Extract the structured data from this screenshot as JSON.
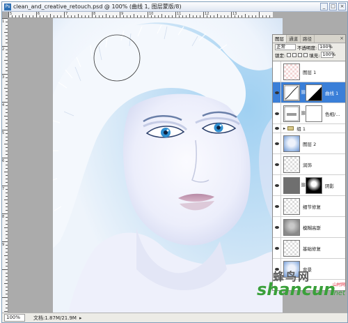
{
  "window": {
    "title": "clean_and_creative_retouch.psd @ 100% (曲线 1, 图层蒙版/8)",
    "app_icon": "Ps",
    "buttons": {
      "minimize": "_",
      "maximize": "□",
      "close": "×"
    }
  },
  "rulers": {
    "top_labels": [
      "5",
      "6",
      "7",
      "8",
      "9",
      "10",
      "11",
      "12",
      "13"
    ],
    "left_labels": [
      "1",
      "2",
      "3",
      "4",
      "5",
      "6",
      "7",
      "8",
      "9"
    ]
  },
  "status_bar": {
    "zoom": "100%",
    "doc_size": "文档:1.87M/21.9M",
    "arrow": "▸"
  },
  "layers_panel": {
    "tabs": [
      "图层",
      "通道",
      "路径"
    ],
    "active_tab": "图层",
    "close": "×",
    "blend_mode": "正常",
    "opacity_label": "不透明度:",
    "opacity_value": "100%",
    "lock_label": "锁定:",
    "fill_label": "填充:",
    "fill_value": "100%",
    "layers": [
      {
        "name": "图层 1",
        "visible": false,
        "selected": false,
        "type": "pixel",
        "thumb": "checker-red"
      },
      {
        "name": "曲线 1",
        "visible": true,
        "selected": true,
        "type": "adjustment",
        "thumb": "curves"
      },
      {
        "name": "色相/...",
        "visible": true,
        "selected": false,
        "type": "adjustment",
        "thumb": "hue"
      },
      {
        "name": "组 1",
        "visible": true,
        "selected": false,
        "type": "group",
        "thumb": "folder"
      },
      {
        "name": "图层 2",
        "visible": true,
        "selected": false,
        "type": "pixel",
        "thumb": "face"
      },
      {
        "name": "润饰",
        "visible": true,
        "selected": false,
        "type": "pixel",
        "thumb": "checker"
      },
      {
        "name": "阴影",
        "visible": true,
        "selected": false,
        "type": "pixel",
        "thumb": "shadow"
      },
      {
        "name": "细节修复",
        "visible": true,
        "selected": false,
        "type": "pixel",
        "thumb": "checker"
      },
      {
        "name": "模糊高斯",
        "visible": true,
        "selected": false,
        "type": "pixel",
        "thumb": "blur"
      },
      {
        "name": "基础修复",
        "visible": true,
        "selected": false,
        "type": "pixel",
        "thumb": "checker"
      },
      {
        "name": "背景",
        "visible": true,
        "selected": false,
        "type": "pixel",
        "thumb": "face"
      }
    ]
  },
  "watermark": {
    "chinese": "蜂鸟网",
    "brand": "shancun",
    "tld": ".net",
    "tag": "山村网"
  }
}
